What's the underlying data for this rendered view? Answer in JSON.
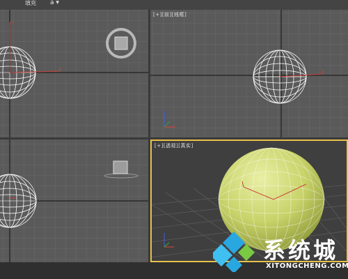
{
  "toolbar": {
    "label": "填充",
    "dropdown_glyph": "a ▾"
  },
  "viewports": {
    "top_right": {
      "label": "[+][前][线框]"
    },
    "bottom_right": {
      "label": "[+][透视][真实]"
    }
  },
  "colors": {
    "grid_bg": "#5a5a5a",
    "grid_line": "#6a6a6a",
    "grid_axis": "#2a2a2a",
    "sphere_fill": "#c9d36a",
    "active_border": "#e7c24a"
  },
  "watermark": {
    "title": "系统城",
    "url": "XITONGCHENG.COM"
  },
  "icons": {
    "viewcube": "viewcube-icon",
    "axis_gizmo": "axis-gizmo-icon",
    "logo": "watermark-logo-icon"
  }
}
